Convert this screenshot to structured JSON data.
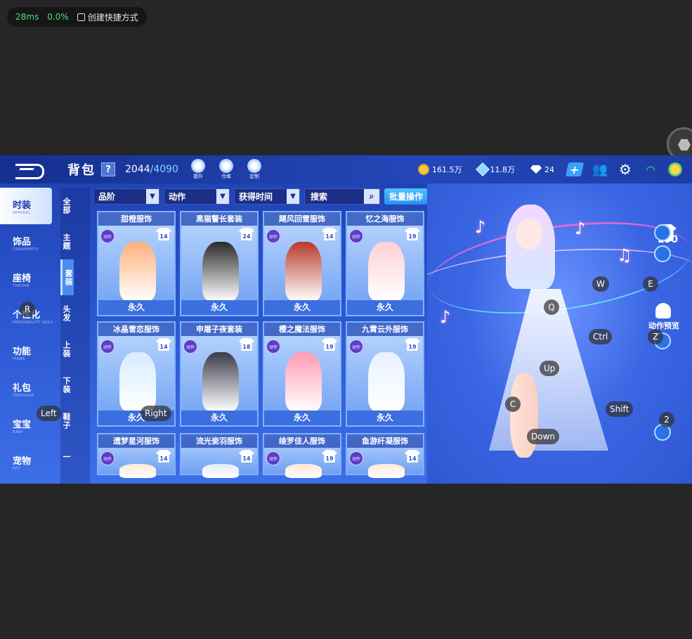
{
  "overlay": {
    "ping": "28ms",
    "loss": "0.0%",
    "shortcut_label": "创建快捷方式"
  },
  "topbar": {
    "title": "背包",
    "help": "?",
    "capacity_used": "2044",
    "capacity_max": "/4090",
    "buttons": [
      {
        "label": "提升",
        "icon": "lightbulb-icon"
      },
      {
        "label": "仓库",
        "icon": "warehouse-icon"
      },
      {
        "label": "定制",
        "icon": "custom-icon"
      }
    ],
    "coins": "161.5万",
    "tickets": "11.8万",
    "diamonds": "24"
  },
  "leftnav": [
    {
      "cn": "时装",
      "en": "APPAREL",
      "active": true
    },
    {
      "cn": "饰品",
      "en": "ORNAMENTS",
      "active": false
    },
    {
      "cn": "座椅",
      "en": "THRONE",
      "active": false
    },
    {
      "cn": "个性化",
      "en": "PERSONALITY SKILL",
      "active": false
    },
    {
      "cn": "功能",
      "en": "ITEMS",
      "active": false
    },
    {
      "cn": "礼包",
      "en": "TREASURE",
      "active": false
    },
    {
      "cn": "宝宝",
      "en": "BABY",
      "active": false
    },
    {
      "cn": "宠物",
      "en": "PET",
      "active": false
    }
  ],
  "subnav": [
    "全部",
    "主题",
    "套装",
    "头发",
    "上装",
    "下装",
    "鞋子",
    "一"
  ],
  "filters": {
    "grade": "品阶",
    "action": "动作",
    "time": "获得时间",
    "search": "搜索",
    "batch": "批量操作"
  },
  "cards": [
    {
      "name": "甜橙服饰",
      "level": "14",
      "badge": "动作",
      "perm": "永久",
      "color": "#ffb07a"
    },
    {
      "name": "黑猫警长套装",
      "level": "24",
      "badge": "",
      "perm": "永久",
      "color": "#2a2a2a"
    },
    {
      "name": "飓风回雪服饰",
      "level": "14",
      "badge": "动作",
      "perm": "永久",
      "color": "#b8392a"
    },
    {
      "name": "忆之海服饰",
      "level": "19",
      "badge": "动作",
      "perm": "永久",
      "color": "#ffd0d6"
    },
    {
      "name": "冰晶雪恋服饰",
      "level": "14",
      "badge": "动作",
      "perm": "永久",
      "color": "#d6ecff"
    },
    {
      "name": "申屠子夜套装",
      "level": "18",
      "badge": "动作",
      "perm": "永久",
      "color": "#3a3a4a"
    },
    {
      "name": "樱之魔法服饰",
      "level": "19",
      "badge": "动作",
      "perm": "永久",
      "color": "#ff9cb4"
    },
    {
      "name": "九霄云外服饰",
      "level": "19",
      "badge": "动作",
      "perm": "永久",
      "color": "#e8f2ff"
    },
    {
      "name": "遗梦星河服饰",
      "level": "14",
      "badge": "动作",
      "perm": "",
      "color": "#fde8d8"
    },
    {
      "name": "流光瓷羽服饰",
      "level": "14",
      "badge": "",
      "perm": "",
      "color": "#e2ecff"
    },
    {
      "name": "绫罗佳人服饰",
      "level": "19",
      "badge": "动作",
      "perm": "",
      "color": "#fde8d8"
    },
    {
      "name": "鱼游纤凝服饰",
      "level": "14",
      "badge": "动作",
      "perm": "",
      "color": "#fde8d8"
    }
  ],
  "stage": {
    "outfit_count": "150",
    "preview_label": "动作预览"
  },
  "keys": [
    "R",
    "Left",
    "Right",
    "W",
    "E",
    "Q",
    "Ctrl",
    "Z",
    "Up",
    "C",
    "Shift",
    "2",
    "Down"
  ]
}
